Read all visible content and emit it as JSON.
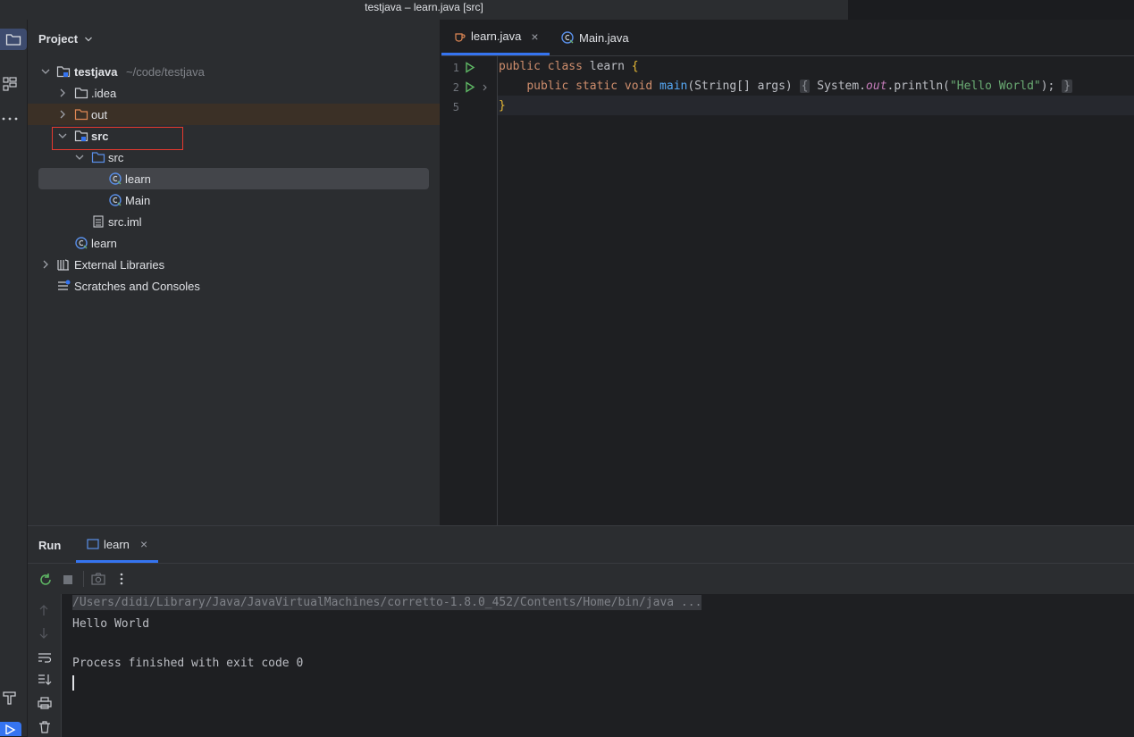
{
  "window": {
    "title": "testjava – learn.java [src]"
  },
  "project_panel": {
    "header": "Project",
    "tree": [
      {
        "label": "testjava",
        "path_hint": "~/code/testjava"
      },
      {
        "label": ".idea"
      },
      {
        "label": "out"
      },
      {
        "label": "src"
      },
      {
        "label": "src"
      },
      {
        "label": "learn"
      },
      {
        "label": "Main"
      },
      {
        "label": "src.iml"
      },
      {
        "label": "learn"
      },
      {
        "label": "External Libraries"
      },
      {
        "label": "Scratches and Consoles"
      }
    ]
  },
  "editor": {
    "tabs": [
      {
        "label": "learn.java",
        "active": true
      },
      {
        "label": "Main.java",
        "active": false
      }
    ],
    "line_numbers": [
      "1",
      "2",
      "5"
    ],
    "code": {
      "l1_kw1": "public",
      "l1_kw2": "class",
      "l1_name": "learn",
      "l1_brace": "{",
      "l2_kw1": "public",
      "l2_kw2": "static",
      "l2_kw3": "void",
      "l2_fn": "main",
      "l2_params": "(String[] args)",
      "l2_open": "{",
      "l2_sys": "System.",
      "l2_out": "out",
      "l2_call": ".println(",
      "l2_str": "\"Hello World\"",
      "l2_end": ");",
      "l2_close": "}",
      "l5_brace": "}"
    }
  },
  "run_panel": {
    "title": "Run",
    "tab": "learn",
    "console": {
      "cmd": "/Users/didi/Library/Java/JavaVirtualMachines/corretto-1.8.0_452/Contents/Home/bin/java ...",
      "out1": "Hello World",
      "out2": "Process finished with exit code 0"
    }
  },
  "colors": {
    "accent": "#3574f0",
    "highlight_box": "#e5392f",
    "excluded_row": "#3b3026"
  }
}
